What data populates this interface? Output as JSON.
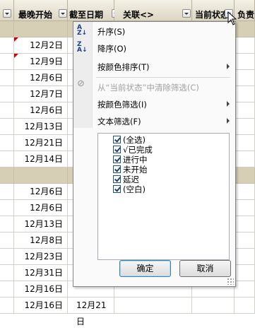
{
  "header": {
    "columns": [
      {
        "label": "最晚开始"
      },
      {
        "label": "截至日期"
      },
      {
        "label": "关联<>"
      },
      {
        "label": "当前状态"
      },
      {
        "label": "负责"
      }
    ]
  },
  "rows": [
    {
      "type": "group"
    },
    {
      "type": "data",
      "date1": "12月2日",
      "date2": "",
      "flag": true
    },
    {
      "type": "data",
      "date1": "12月9日",
      "date2": "",
      "flag": true
    },
    {
      "type": "data",
      "date1": "12月6日",
      "date2": ""
    },
    {
      "type": "data",
      "date1": "12月7日",
      "date2": ""
    },
    {
      "type": "data",
      "date1": "12月6日",
      "date2": ""
    },
    {
      "type": "data",
      "date1": "12月13日",
      "date2": ""
    },
    {
      "type": "data",
      "date1": "12月21日",
      "date2": ""
    },
    {
      "type": "data",
      "date1": "12月14日",
      "date2": ""
    },
    {
      "type": "group"
    },
    {
      "type": "data",
      "date1": "12月6日",
      "date2": ""
    },
    {
      "type": "data",
      "date1": "12月6日",
      "date2": ""
    },
    {
      "type": "data",
      "date1": "12月13日",
      "date2": ""
    },
    {
      "type": "data",
      "date1": "12月8日",
      "date2": ""
    },
    {
      "type": "data",
      "date1": "12月23日",
      "date2": ""
    },
    {
      "type": "data",
      "date1": "12月31日",
      "date2": ""
    },
    {
      "type": "data",
      "date1": "12月16日",
      "date2": ""
    },
    {
      "type": "data",
      "date1": "12月16日",
      "date2": "12月21日"
    }
  ],
  "filter_menu": {
    "sort_asc": "升序(S)",
    "sort_desc": "降序(O)",
    "sort_by_color": "按颜色排序(T)",
    "clear_filter": "从“当前状态”中清除筛选(C)",
    "filter_by_color": "按颜色筛选(I)",
    "text_filter": "文本筛选(F)",
    "checklist": [
      {
        "label": "(全选)",
        "checked": true
      },
      {
        "label": "√已完成",
        "checked": true
      },
      {
        "label": "进行中",
        "checked": true
      },
      {
        "label": "未开始",
        "checked": true
      },
      {
        "label": "延迟",
        "checked": true
      },
      {
        "label": "(空白)",
        "checked": true
      }
    ],
    "ok_label": "确定",
    "cancel_label": "取消"
  },
  "colors": {
    "header_bg": "#dcd6c2",
    "group_row_bg": "#d6cfb6",
    "comment_marker": "#cc0000",
    "menu_bg": "#fafafa"
  }
}
